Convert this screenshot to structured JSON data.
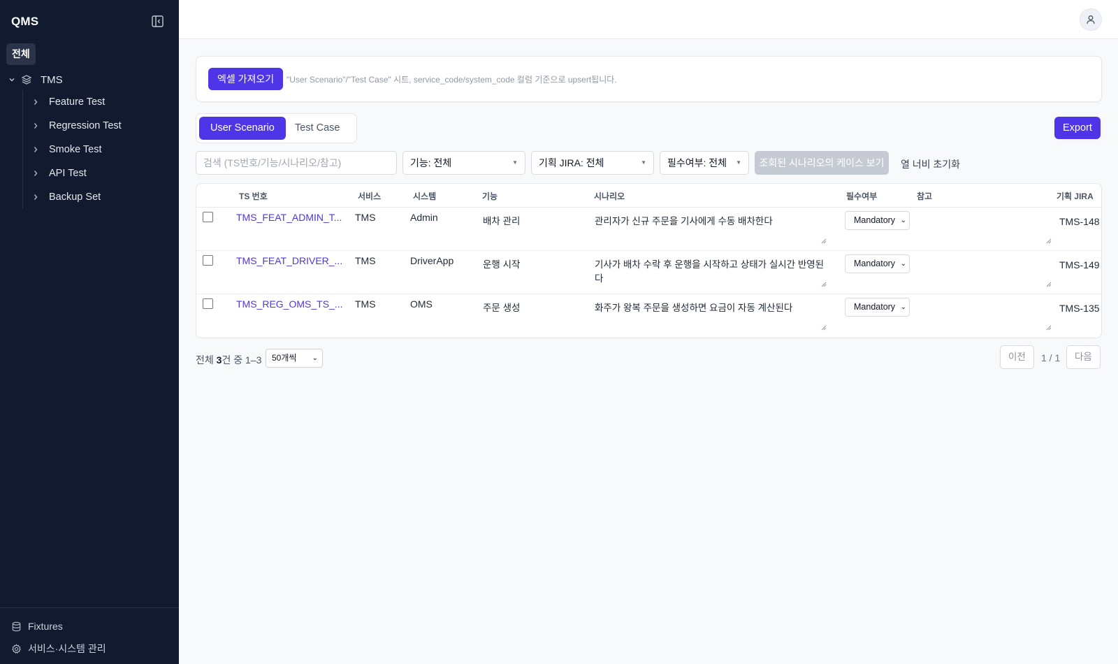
{
  "app": {
    "name": "QMS"
  },
  "sidebar": {
    "all_label": "전체",
    "root": {
      "label": "TMS"
    },
    "children": [
      {
        "label": "Feature Test"
      },
      {
        "label": "Regression Test"
      },
      {
        "label": "Smoke Test"
      },
      {
        "label": "API Test"
      },
      {
        "label": "Backup Set"
      }
    ],
    "footer": {
      "fixtures_label": "Fixtures",
      "settings_label": "서비스·시스템 관리"
    }
  },
  "import": {
    "button_label": "엑셀 가져오기",
    "hint": "\"User Scenario\"/\"Test Case\" 시트, service_code/system_code 컬럼 기준으로 upsert됩니다."
  },
  "tabs": [
    {
      "label": "User Scenario",
      "active": true
    },
    {
      "label": "Test Case",
      "active": false
    }
  ],
  "export_label": "Export",
  "filters": {
    "search_placeholder": "검색 (TS번호/기능/시나리오/참고)",
    "feature_select": "기능: 전체",
    "jira_select": "기획 JIRA: 전체",
    "mandatory_select": "필수여부: 전체",
    "view_cases_button": "조회된 시나리오의 케이스 보기",
    "reset_widths_link": "열 너비 초기화"
  },
  "table": {
    "columns": [
      "TS 번호",
      "서비스",
      "시스템",
      "기능",
      "시나리오",
      "필수여부",
      "참고",
      "기획 JIRA"
    ],
    "rows": [
      {
        "ts": "TMS_FEAT_ADMIN_T...",
        "service": "TMS",
        "system": "Admin",
        "feature": "배차 관리",
        "scenario": "관리자가 신규 주문을 기사에게 수동 배차한다",
        "mandatory": "Mandatory",
        "note": "",
        "jira": "TMS-148"
      },
      {
        "ts": "TMS_FEAT_DRIVER_...",
        "service": "TMS",
        "system": "DriverApp",
        "feature": "운행 시작",
        "scenario": "기사가 배차 수락 후 운행을 시작하고 상태가 실시간 반영된다",
        "mandatory": "Mandatory",
        "note": "",
        "jira": "TMS-149"
      },
      {
        "ts": "TMS_REG_OMS_TS_...",
        "service": "TMS",
        "system": "OMS",
        "feature": "주문 생성",
        "scenario": "화주가 왕복 주문을 생성하면 요금이 자동 계산된다",
        "mandatory": "Mandatory",
        "note": "",
        "jira": "TMS-135"
      }
    ]
  },
  "pagination": {
    "summary_prefix": "전체 ",
    "total": "3",
    "summary_suffix": "건 중 1–3",
    "page_size": "50개씩",
    "prev_label": "이전",
    "page_info": "1 / 1",
    "next_label": "다음"
  },
  "colors": {
    "accent": "#4f35e8",
    "sidebar_bg": "#111a2e",
    "disabled_button": "#c6cbd3"
  },
  "icons": {
    "collapse": "sidebar-collapse-icon",
    "tree_root": "layers-icon",
    "fixtures": "database-icon",
    "settings": "gear-icon",
    "user": "user-icon"
  }
}
